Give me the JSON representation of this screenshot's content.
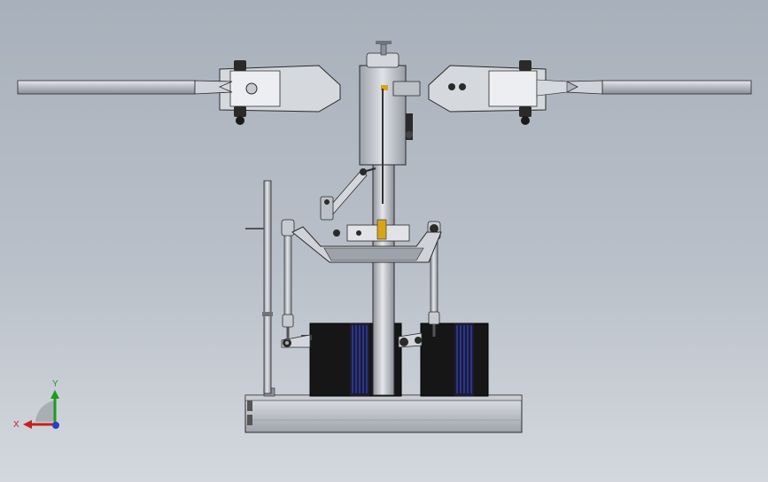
{
  "viewport": {
    "background": "gradient-grey",
    "model": "helicopter-rotor-head-swashplate-assembly",
    "view": "front"
  },
  "triad": {
    "x_label": "X",
    "y_label": "Y",
    "x_color": "#c8201c",
    "y_color": "#1f9a1f",
    "z_color": "#2a3fbf"
  },
  "colors": {
    "metal_light": "#d3d6dc",
    "metal_mid": "#a9adb6",
    "metal_dark": "#6f737b",
    "servo_black": "#161616",
    "servo_blue": "#2b3aa8",
    "brass": "#d8a418",
    "outline": "#2a2a2a"
  }
}
